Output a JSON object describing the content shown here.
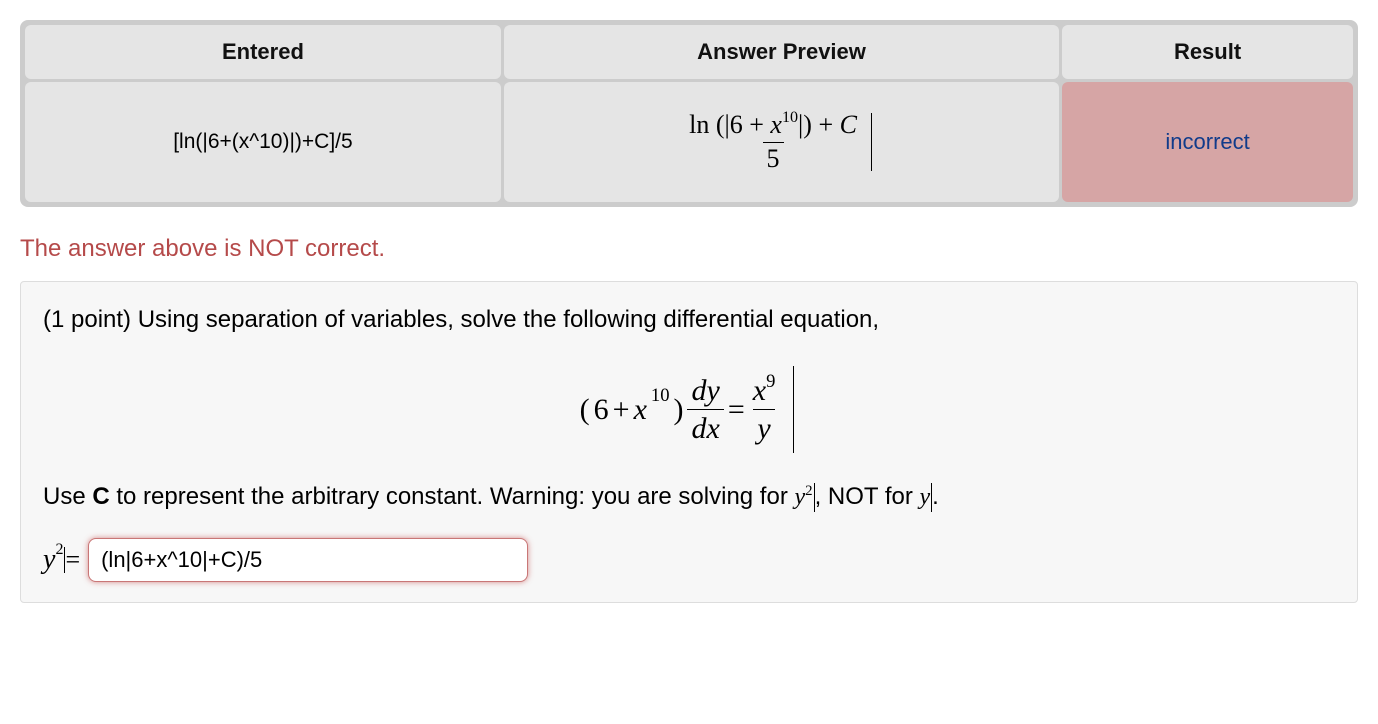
{
  "table": {
    "headers": {
      "entered": "Entered",
      "preview": "Answer Preview",
      "result": "Result"
    },
    "row": {
      "entered": "[ln(|6+(x^10)|)+C]/5",
      "preview": {
        "ln_label": "ln",
        "inner_const": "6",
        "inner_plus": " + ",
        "inner_var": "x",
        "inner_exp": "10",
        "plus_c": " + ",
        "C": "C",
        "den": "5"
      },
      "result": "incorrect"
    }
  },
  "not_correct": "The answer above is NOT correct.",
  "problem": {
    "points_prefix": "(1 point) ",
    "text": "Using separation of variables, solve the following differential equation,",
    "equation": {
      "lhs_const": "6",
      "lhs_plus": " + ",
      "lhs_var": "x",
      "lhs_exp": "10",
      "frac1_num_d": "d",
      "frac1_num_y": "y",
      "frac1_den_d": "d",
      "frac1_den_x": "x",
      "eq": " = ",
      "rhs_num_var": "x",
      "rhs_num_exp": "9",
      "rhs_den": "y"
    },
    "note_before": "Use ",
    "note_bold": "C",
    "note_after": " to represent the arbitrary constant. Warning: you are solving for ",
    "note_y2_var": "y",
    "note_y2_exp": "2",
    "note_mid": " NOT for ",
    "note_yvar": "y",
    "label_var": "y",
    "label_exp": "2",
    "label_eq": " = ",
    "input_value": "(ln|6+x^10|+C)/5"
  }
}
